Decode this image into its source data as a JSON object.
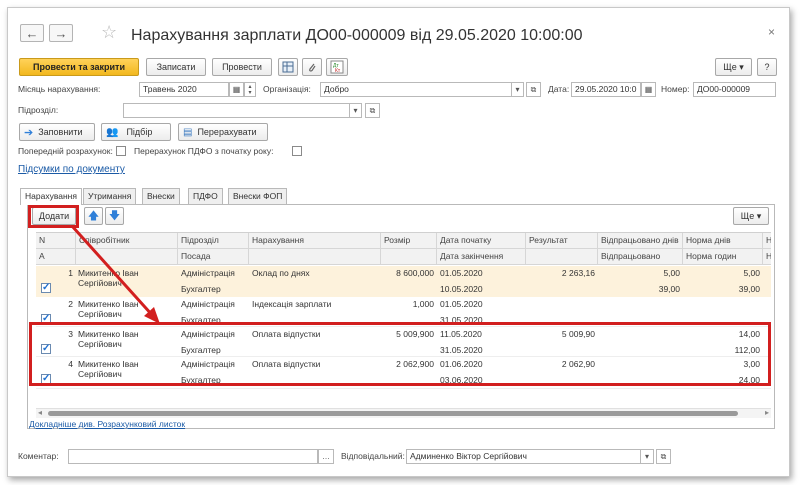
{
  "window": {
    "title": "Нарахування зарплати ДО00-000009 від 29.05.2020 10:00:00",
    "close_symbol": "×",
    "back_symbol": "←",
    "forward_symbol": "→",
    "star_symbol": "☆"
  },
  "toolbar": {
    "post_and_close": "Провести та закрити",
    "save": "Записати",
    "post": "Провести",
    "more": "Ще ▾",
    "help": "?"
  },
  "fields": {
    "month_label": "Місяць нарахування:",
    "month_value": "Травень 2020",
    "org_label": "Організація:",
    "org_value": "Добро",
    "date_label": "Дата:",
    "date_value": "29.05.2020 10:0",
    "number_label": "Номер:",
    "number_value": "ДО00-000009",
    "dept_label": "Підрозділ:",
    "dept_value": ""
  },
  "actions": {
    "fill": "Заповнити",
    "select": "Підбір",
    "recalc": "Перерахувати"
  },
  "options": {
    "preliminary_label": "Попередній розрахунок:",
    "recalc_pdfo_label": "Перерахунок ПДФО з початку року:"
  },
  "links": {
    "summary": "Підсумки по документу",
    "details": "Докладніше див. Розрахунковий листок"
  },
  "tabs": [
    "Нарахування",
    "Утримання",
    "Внески",
    "ПДФО",
    "Внески ФОП"
  ],
  "grid": {
    "add_button": "Додати",
    "more_button": "Ще ▾",
    "header_row1": [
      "N",
      "Співробітник",
      "Підрозділ",
      "Нарахування",
      "Розмір",
      "Дата початку",
      "Результат",
      "Відпрацьовано днів",
      "Норма днів",
      "Н"
    ],
    "header_row2": [
      "А",
      "",
      "Посада",
      "",
      "",
      "Дата закінчення",
      "",
      "Відпрацьовано",
      "Норма годин",
      "Н"
    ],
    "rows": [
      {
        "n": "1",
        "employee": "Микитенко Іван Сергійович",
        "dept": "Адміністрація",
        "position": "Бухгалтер",
        "accrual": "Оклад по днях",
        "size": "8 600,000",
        "start": "01.05.2020",
        "end": "10.05.2020",
        "result": "2 263,16",
        "worked_days": "5,00",
        "worked_hours": "39,00",
        "norm_days": "5,00",
        "norm_hours": "39,00",
        "checked": true
      },
      {
        "n": "2",
        "employee": "Микитенко Іван Сергійович",
        "dept": "Адміністрація",
        "position": "Бухгалтер",
        "accrual": "Індексація зарплати",
        "size": "1,000",
        "start": "01.05.2020",
        "end": "31.05.2020",
        "result": "",
        "worked_days": "",
        "worked_hours": "",
        "norm_days": "",
        "norm_hours": "",
        "checked": true
      },
      {
        "n": "3",
        "employee": "Микитенко Іван Сергійович",
        "dept": "Адміністрація",
        "position": "Бухгалтер",
        "accrual": "Оплата відпустки",
        "size": "5 009,900",
        "start": "11.05.2020",
        "end": "31.05.2020",
        "result": "5 009,90",
        "worked_days": "",
        "worked_hours": "",
        "norm_days": "14,00",
        "norm_hours": "112,00",
        "checked": true
      },
      {
        "n": "4",
        "employee": "Микитенко Іван Сергійович",
        "dept": "Адміністрація",
        "position": "Бухгалтер",
        "accrual": "Оплата відпустки",
        "size": "2 062,900",
        "start": "01.06.2020",
        "end": "03.06.2020",
        "result": "2 062,90",
        "worked_days": "",
        "worked_hours": "",
        "norm_days": "3,00",
        "norm_hours": "24,00",
        "checked": true
      }
    ]
  },
  "footer": {
    "comment_label": "Коментар:",
    "comment_value": "",
    "responsible_label": "Відповідальний:",
    "responsible_value": "Админенко Віктор Сергійович"
  },
  "colors": {
    "primary_button": "#f2b81e",
    "highlight_row": "#fdf2dc",
    "annotation_red": "#d21f1f",
    "link": "#1a5aa6",
    "arrow_icon": "#2f7fd8"
  }
}
